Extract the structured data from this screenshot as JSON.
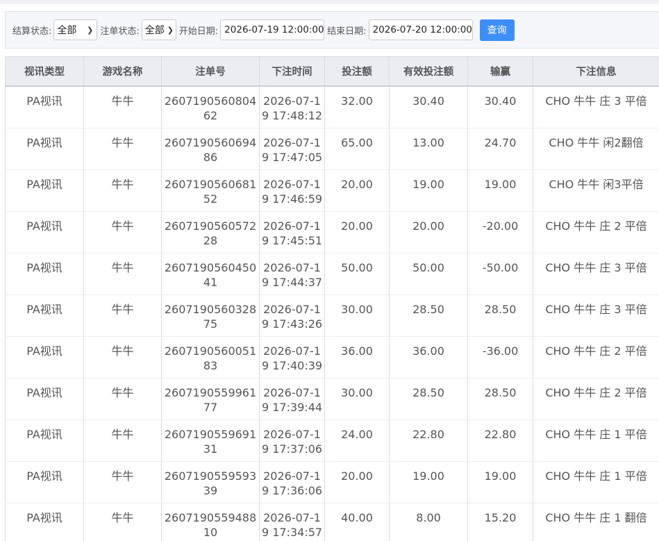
{
  "filters": {
    "settle_label": "结算状态:",
    "settle_value": "全部",
    "order_label": "注单状态:",
    "order_value": "全部",
    "start_label": "开始日期:",
    "start_value": "2026-07-19 12:00:00",
    "end_label": "结束日期:",
    "end_value": "2026-07-20 12:00:00",
    "query_label": "查询"
  },
  "table": {
    "headers": [
      "视讯类型",
      "游戏名称",
      "注单号",
      "下注时间",
      "投注额",
      "有效投注额",
      "输赢",
      "下注信息"
    ],
    "rows": [
      [
        "PA视讯",
        "牛牛",
        "260719056080462",
        "2026-07-19 17:48:12",
        "32.00",
        "30.40",
        "30.40",
        "CHO 牛牛 庄 3 平倍"
      ],
      [
        "PA视讯",
        "牛牛",
        "260719056069486",
        "2026-07-19 17:47:05",
        "65.00",
        "13.00",
        "24.70",
        "CHO 牛牛 闲2翻倍"
      ],
      [
        "PA视讯",
        "牛牛",
        "260719056068152",
        "2026-07-19 17:46:59",
        "20.00",
        "19.00",
        "19.00",
        "CHO 牛牛 闲3平倍"
      ],
      [
        "PA视讯",
        "牛牛",
        "260719056057228",
        "2026-07-19 17:45:51",
        "20.00",
        "20.00",
        "-20.00",
        "CHO 牛牛 庄 2 平倍"
      ],
      [
        "PA视讯",
        "牛牛",
        "260719056045041",
        "2026-07-19 17:44:37",
        "50.00",
        "50.00",
        "-50.00",
        "CHO 牛牛 庄 3 平倍"
      ],
      [
        "PA视讯",
        "牛牛",
        "260719056032875",
        "2026-07-19 17:43:26",
        "30.00",
        "28.50",
        "28.50",
        "CHO 牛牛 庄 3 平倍"
      ],
      [
        "PA视讯",
        "牛牛",
        "260719056005183",
        "2026-07-19 17:40:39",
        "36.00",
        "36.00",
        "-36.00",
        "CHO 牛牛 庄 2 平倍"
      ],
      [
        "PA视讯",
        "牛牛",
        "260719055996177",
        "2026-07-19 17:39:44",
        "30.00",
        "28.50",
        "28.50",
        "CHO 牛牛 庄 2 平倍"
      ],
      [
        "PA视讯",
        "牛牛",
        "260719055969131",
        "2026-07-19 17:37:06",
        "24.00",
        "22.80",
        "22.80",
        "CHO 牛牛 庄 1 平倍"
      ],
      [
        "PA视讯",
        "牛牛",
        "260719055959339",
        "2026-07-19 17:36:06",
        "20.00",
        "19.00",
        "19.00",
        "CHO 牛牛 庄 1 平倍"
      ],
      [
        "PA视讯",
        "牛牛",
        "260719055948810",
        "2026-07-19 17:34:57",
        "40.00",
        "8.00",
        "15.20",
        "CHO 牛牛 庄 1 翻倍"
      ]
    ]
  }
}
